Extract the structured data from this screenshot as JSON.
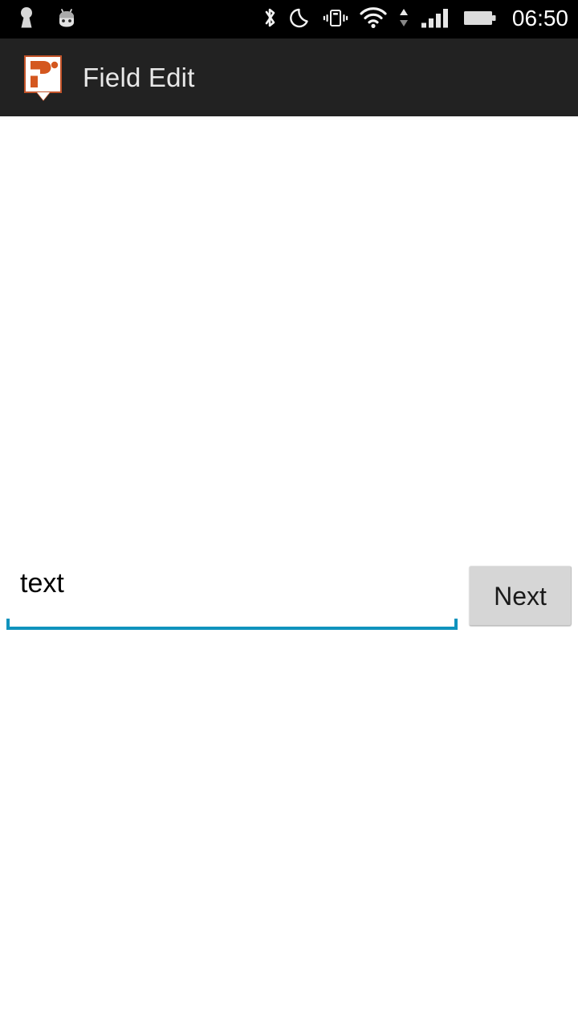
{
  "status_bar": {
    "background": "#000000",
    "clock": "06:50",
    "left_icons": [
      {
        "name": "vpn-keyhole-icon",
        "label": "VPN"
      },
      {
        "name": "android-head-icon",
        "label": "Android"
      }
    ],
    "right_icons": [
      {
        "name": "bluetooth-icon",
        "label": "Bluetooth"
      },
      {
        "name": "do-not-disturb-moon-icon",
        "label": "Do not disturb"
      },
      {
        "name": "vibrate-icon",
        "label": "Vibrate"
      },
      {
        "name": "wifi-icon",
        "label": "Wi-Fi"
      },
      {
        "name": "data-transfer-arrows-icon",
        "label": "Data transfer"
      },
      {
        "name": "cellular-signal-icon",
        "label": "Signal"
      },
      {
        "name": "battery-icon",
        "label": "Battery"
      }
    ]
  },
  "action_bar": {
    "background": "#222222",
    "title": "Field Edit",
    "logo": {
      "name": "app-logo-icon",
      "glyph": "P",
      "accent": "#d4571f",
      "border": "#c4542a",
      "fill": "#ffffff"
    }
  },
  "main": {
    "text_field": {
      "value": "text",
      "placeholder": "",
      "underline_color": "#1093bd"
    },
    "next_button": {
      "label": "Next",
      "background": "#d6d6d6",
      "text_color": "#1a1a1a"
    }
  }
}
